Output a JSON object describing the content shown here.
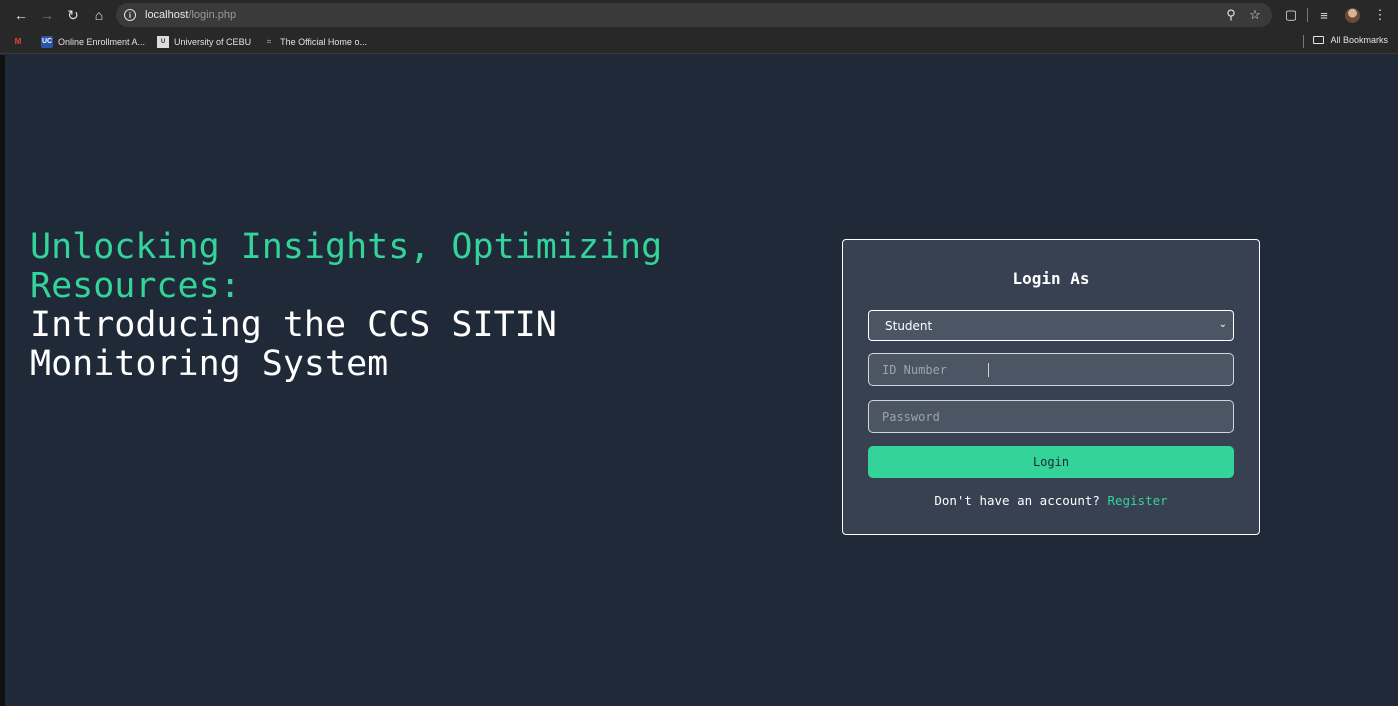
{
  "browser": {
    "url_host": "localhost",
    "url_path": "/login.php",
    "bookmarks": [
      {
        "label": "Online Enrollment A...",
        "icon": "uc-icon"
      },
      {
        "label": "University of CEBU",
        "icon": "uoc-icon"
      },
      {
        "label": "The Official Home o...",
        "icon": "cebu-icon"
      }
    ],
    "all_bookmarks_label": "All Bookmarks"
  },
  "hero": {
    "accent_text": "Unlocking Insights, Optimizing Resources:",
    "main_text": "Introducing the CCS SITIN Monitoring System"
  },
  "login": {
    "title": "Login As",
    "role_selected": "Student",
    "id_placeholder": "ID Number",
    "password_placeholder": "Password",
    "login_label": "Login",
    "register_prompt": "Don't have an account?",
    "register_link": "Register"
  },
  "colors": {
    "accent": "#34d399",
    "background": "#1f2937",
    "card": "#374151",
    "input": "#4b5563"
  }
}
